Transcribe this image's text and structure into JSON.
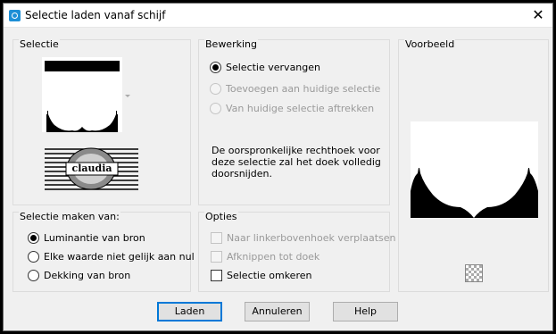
{
  "window": {
    "title": "Selectie laden vanaf schijf",
    "close_label": "✕"
  },
  "selectie": {
    "heading": "Selectie",
    "logo_text": "claudia"
  },
  "bewerking": {
    "heading": "Bewerking",
    "options": [
      {
        "label": "Selectie vervangen",
        "checked": true,
        "enabled": true
      },
      {
        "label": "Toevoegen aan huidige selectie",
        "checked": false,
        "enabled": false
      },
      {
        "label": "Van huidige selectie aftrekken",
        "checked": false,
        "enabled": false
      }
    ],
    "note": [
      "De oorspronkelijke rechthoek voor",
      "deze selectie zal het doek volledig",
      "doorsnijden."
    ]
  },
  "voorbeeld": {
    "heading": "Voorbeeld"
  },
  "maken_van": {
    "heading": "Selectie maken van:",
    "options": [
      {
        "label": "Luminantie van bron",
        "checked": true
      },
      {
        "label": "Elke waarde niet gelijk aan nul",
        "checked": false
      },
      {
        "label": "Dekking van bron",
        "checked": false
      }
    ]
  },
  "opties": {
    "heading": "Opties",
    "items": [
      {
        "label": "Naar linkerbovenhoek verplaatsen",
        "checked": false,
        "enabled": false
      },
      {
        "label": "Afknippen tot doek",
        "checked": false,
        "enabled": false
      },
      {
        "label": "Selectie omkeren",
        "checked": false,
        "enabled": true
      }
    ]
  },
  "buttons": {
    "load": "Laden",
    "cancel": "Annuleren",
    "help": "Help"
  }
}
